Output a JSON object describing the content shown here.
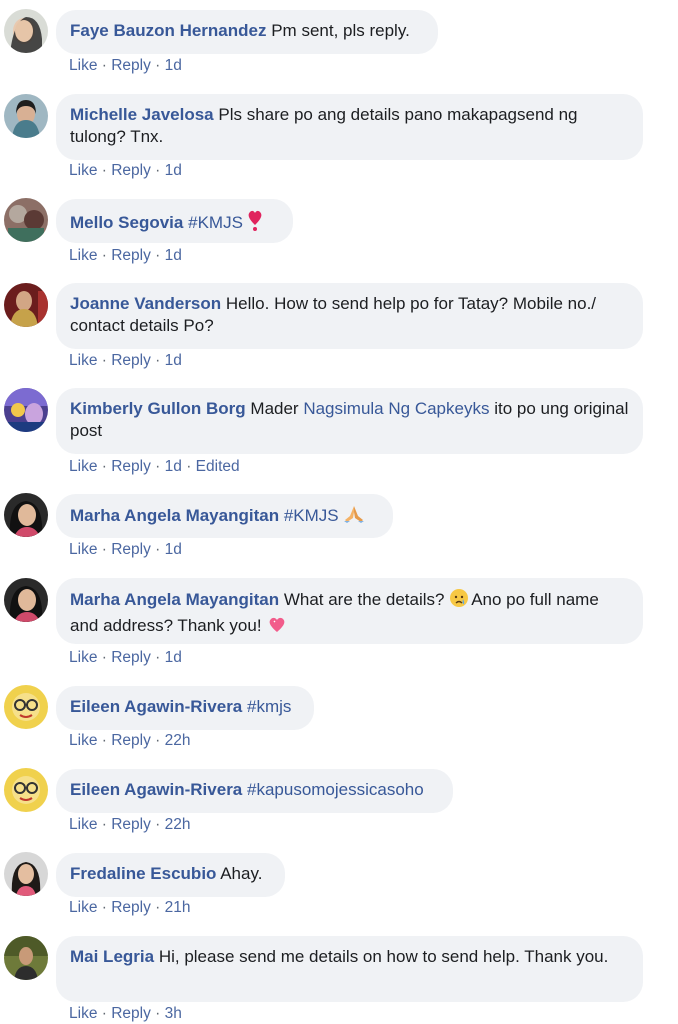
{
  "comments": [
    {
      "author": "Faye Bauzon Hernandez",
      "text": " Pm sent, pls reply.",
      "actions": {
        "like": "Like",
        "reply": "Reply",
        "time": "1d"
      }
    },
    {
      "author": "Michelle Javelosa",
      "text": " Pls share po ang details pano makapagsend ng tulong? Tnx.",
      "actions": {
        "like": "Like",
        "reply": "Reply",
        "time": "1d"
      }
    },
    {
      "author": "Mello Segovia",
      "tag": "#KMJS",
      "emoji": "heart-exclamation",
      "actions": {
        "like": "Like",
        "reply": "Reply",
        "time": "1d"
      }
    },
    {
      "author": "Joanne Vanderson",
      "text": " Hello. How to send help po for Tatay? Mobile no./ contact details Po?",
      "actions": {
        "like": "Like",
        "reply": "Reply",
        "time": "1d"
      }
    },
    {
      "author": "Kimberly Gullon Borg",
      "text_before": " Mader ",
      "mention": "Nagsimula Ng Capkeyks",
      "text_after": " ito po ung original post",
      "actions": {
        "like": "Like",
        "reply": "Reply",
        "time": "1d",
        "edited": "Edited"
      }
    },
    {
      "author": "Marha Angela Mayangitan",
      "tag": "#KMJS",
      "emoji": "folded-hands",
      "actions": {
        "like": "Like",
        "reply": "Reply",
        "time": "1d"
      }
    },
    {
      "author": "Marha Angela Mayangitan",
      "text_before": " What are the details? ",
      "text_after": "Ano po full name and address? Thank you! ",
      "emoji_mid": "crying-face",
      "emoji_end": "sparkling-heart",
      "actions": {
        "like": "Like",
        "reply": "Reply",
        "time": "1d"
      }
    },
    {
      "author": "Eileen Agawin-Rivera",
      "tag": "#kmjs",
      "actions": {
        "like": "Like",
        "reply": "Reply",
        "time": "22h"
      }
    },
    {
      "author": "Eileen Agawin-Rivera",
      "tag": "#kapusomojessicasoho",
      "actions": {
        "like": "Like",
        "reply": "Reply",
        "time": "22h"
      }
    },
    {
      "author": "Fredaline Escubio",
      "text": " Ahay.",
      "actions": {
        "like": "Like",
        "reply": "Reply",
        "time": "21h"
      }
    },
    {
      "author": "Mai Legria",
      "text": " Hi, please send me details on how to send help. Thank you.",
      "actions": {
        "like": "Like",
        "reply": "Reply",
        "time": "3h"
      }
    }
  ],
  "separator": " · "
}
